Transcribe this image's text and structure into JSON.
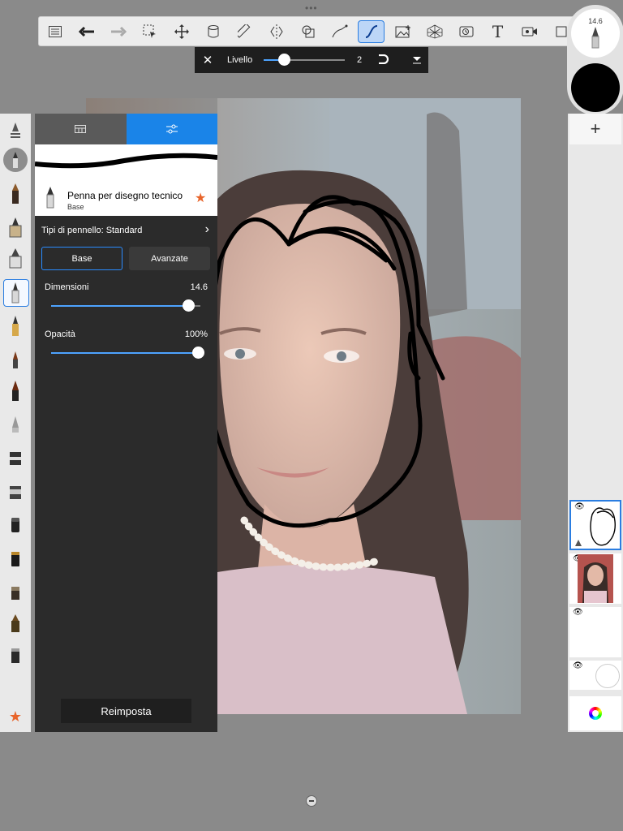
{
  "toolbar": {
    "icons": [
      "list-icon",
      "undo-icon",
      "redo-icon",
      "selection-icon",
      "transform-icon",
      "fill-icon",
      "ruler-icon",
      "symmetry-icon",
      "shape-icon",
      "curve-icon",
      "stroke-icon",
      "image-icon",
      "perspective-icon",
      "timelapse-icon",
      "text-icon",
      "video-icon",
      "crop-icon"
    ],
    "text_glyph": "T"
  },
  "level_bar": {
    "label": "Livello",
    "value": "2",
    "slider_level": 0.3
  },
  "brush_preview": {
    "size": "14.6",
    "color": "#000000"
  },
  "panel": {
    "brush_name": "Penna per disegno tecnico",
    "brush_sub": "Base",
    "brush_types": "Tipi di pennello: Standard",
    "tab_base": "Base",
    "tab_advanced": "Avanzate",
    "size_label": "Dimensioni",
    "size_value": "14.6",
    "size_level": 0.85,
    "opacity_label": "Opacità",
    "opacity_value": "100%",
    "opacity_level": 1.0,
    "reset_label": "Reimposta"
  },
  "right": {
    "add_label": "+"
  },
  "layers": [
    {
      "name": "layer-sketch",
      "visible": true
    },
    {
      "name": "layer-photo",
      "visible": true
    },
    {
      "name": "layer-empty",
      "visible": true
    },
    {
      "name": "layer-background",
      "visible": true
    }
  ],
  "colors": {
    "accent": "#1a84e8",
    "favorite": "#e8642a"
  }
}
